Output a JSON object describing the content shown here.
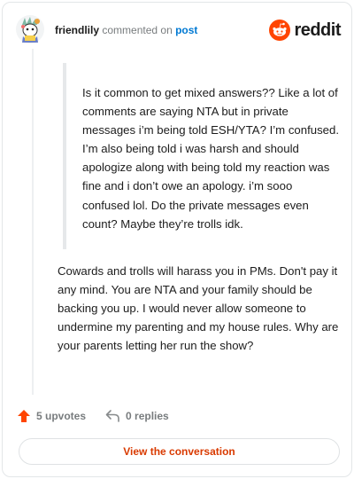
{
  "header": {
    "username": "friendlily",
    "action_text": "commented on",
    "target_link": "post",
    "logo_text": "reddit"
  },
  "quote": {
    "text": "Is it common to get mixed answers?? Like a lot of comments are saying NTA but in private messages i’m being told ESH/YTA? I’m confused. I’m also being told i was harsh and should apologize along with being told my reaction was fine and i don’t owe an apology. i’m sooo confused lol. Do the private messages even count? Maybe they’re trolls idk."
  },
  "comment": {
    "text": "Cowards and trolls will harass you in PMs. Don't pay it any mind. You are NTA and your family should be backing you up. I would never allow someone to undermine my parenting and my house rules. Why are your parents letting her run the show?"
  },
  "actions": {
    "upvotes": "5 upvotes",
    "replies": "0 replies"
  },
  "view_button": "View the conversation",
  "colors": {
    "brand": "#ff4500",
    "link": "#0079d3",
    "button_text": "#d93a00"
  },
  "icons": [
    "avatar",
    "reddit-logo-icon",
    "upvote-icon",
    "reply-icon"
  ]
}
